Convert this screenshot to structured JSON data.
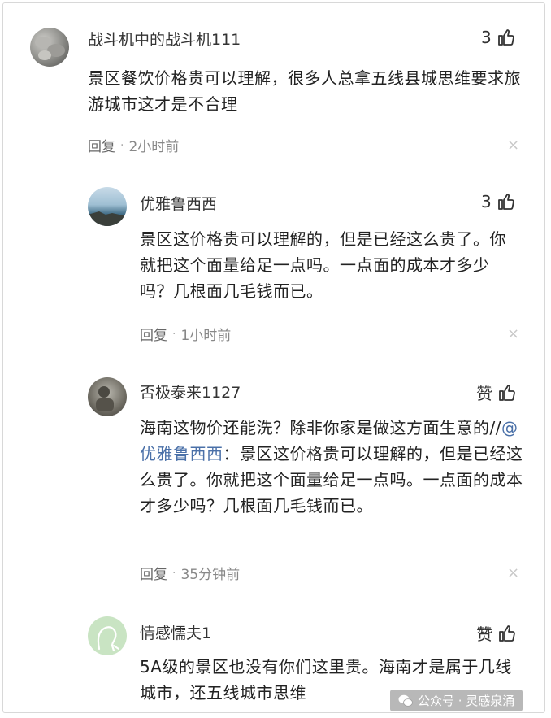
{
  "comments": [
    {
      "username": "战斗机中的战斗机111",
      "likes": "3",
      "text": "景区餐饮价格贵可以理解，很多人总拿五线县城思维要求旅游城市这才是不合理",
      "reply_label": "回复",
      "time": "2小时前"
    },
    {
      "username": "优雅鲁西西",
      "likes": "3",
      "text": "景区这价格贵可以理解的，但是已经这么贵了。你就把这个面量给足一点吗。一点面的成本才多少吗？几根面几毛钱而已。",
      "reply_label": "回复",
      "time": "1小时前"
    },
    {
      "username": "否极泰来1127",
      "likes": "赞",
      "text_prefix": "海南这物价还能洗？除非你家是做这方面生意的//",
      "mention": "@优雅鲁西西",
      "text_suffix": "：景区这价格贵可以理解的，但是已经这么贵了。你就把这个面量给足一点吗。一点面的成本才多少吗？几根面几毛钱而已。",
      "reply_label": "回复",
      "time": "35分钟前"
    },
    {
      "username": "情感懦夫1",
      "likes": "赞",
      "text": "5A级的景区也没有你们这里贵。海南才是属于几线城市，还五线城市思维"
    }
  ],
  "watermark": {
    "text": "公众号 · 灵感泉涌",
    "icon": "wechat-icon"
  },
  "colors": {
    "mention": "#4a70a8",
    "meta": "#666666"
  }
}
